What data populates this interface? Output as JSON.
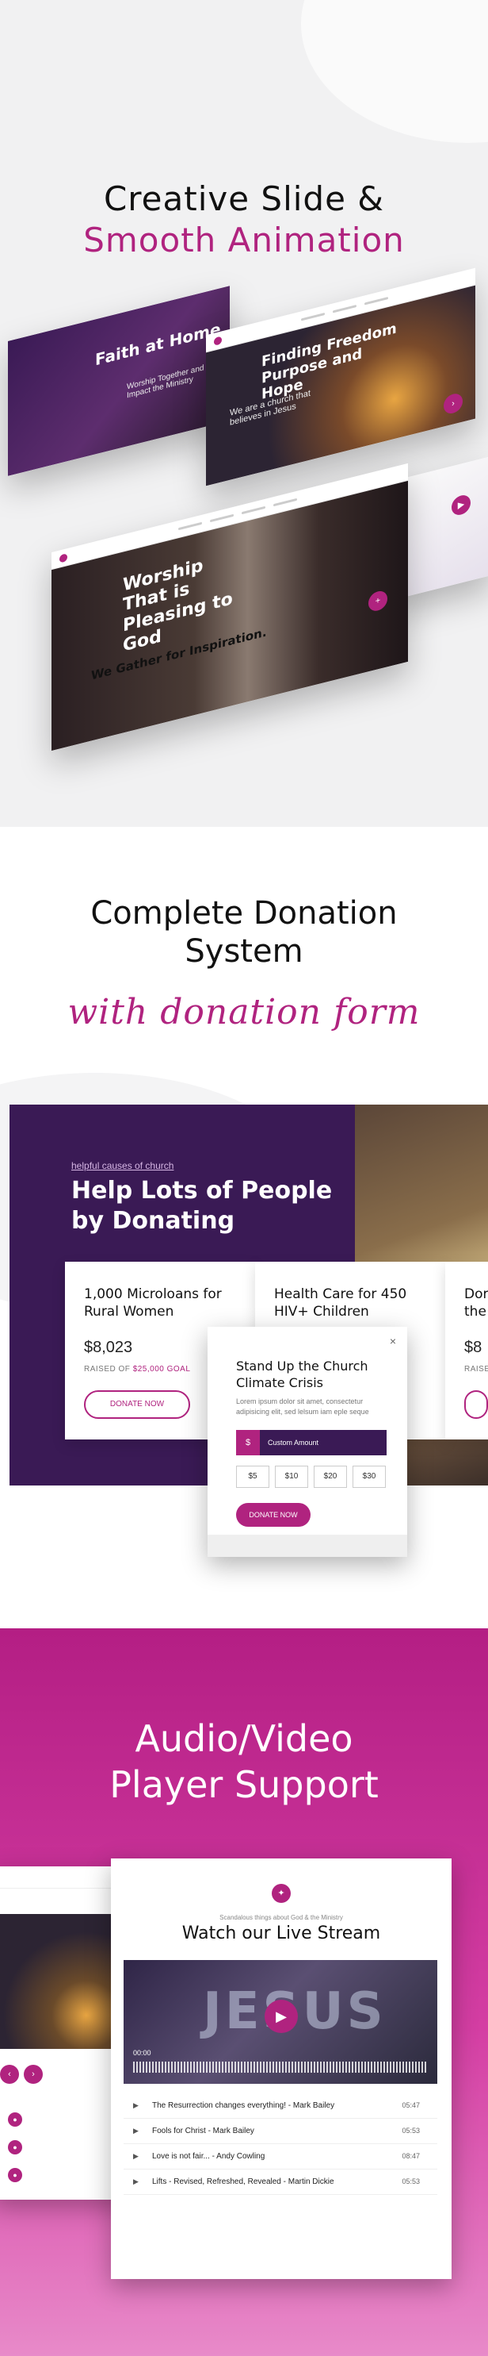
{
  "section1": {
    "heading_line1": "Creative Slide &",
    "heading_line2": "Smooth Animation",
    "slide_a": {
      "title": "Faith at Home",
      "sub": "Worship Together and Impact the Ministry"
    },
    "slide_b": {
      "title": "Finding Freedom Purpose and Hope",
      "sub": "We are a church that believes in Jesus"
    },
    "slide_c": {
      "title": "Worship That is Pleasing to God",
      "caption": "We Gather for Inspiration."
    }
  },
  "section2": {
    "heading_line1": "Complete Donation",
    "heading_line2": "System",
    "script": "with donation form",
    "link": "helpful causes of church",
    "big_line1": "Help Lots of People",
    "big_line2": "by Donating",
    "cards": [
      {
        "title_line1": "1,000 Microloans for",
        "title_line2": "Rural Women",
        "amount": "$8,023",
        "raised_prefix": "RAISED OF ",
        "raised_goal": "$25,000 GOAL",
        "button": "DONATE NOW"
      },
      {
        "title_line1": "Health Care for 450",
        "title_line2": "HIV+ Children"
      },
      {
        "title_line1": "Dor",
        "title_line2": "the",
        "amount": "$8",
        "raised_prefix": "RAISE"
      }
    ],
    "modal": {
      "close": "×",
      "title_line1": "Stand Up the Church",
      "title_line2": "Climate Crisis",
      "desc": "Lorem ipsum dolor sit amet, consectetur adipisicing elit, sed lelsum iam eple seque",
      "currency": "$",
      "custom": "Custom Amount",
      "amounts": [
        "$5",
        "$10",
        "$20",
        "$30"
      ],
      "button": "DONATE NOW"
    }
  },
  "section3": {
    "heading_line1": "Audio/Video",
    "heading_line2": "Player Support",
    "small": "Scandalous things about God & the Ministry",
    "title": "Watch our Live Stream",
    "video_word": "JESUS",
    "time": "00:00",
    "tracks": [
      {
        "title": "The Resurrection changes everything! - Mark Bailey",
        "length": "05:47"
      },
      {
        "title": "Fools for Christ - Mark Bailey",
        "length": "05:53"
      },
      {
        "title": "Love is not fair... - Andy Cowling",
        "length": "08:47"
      },
      {
        "title": "Lifts - Revised, Refreshed, Revealed - Martin Dickie",
        "length": "05:53"
      }
    ]
  },
  "colors": {
    "accent": "#b0237f",
    "purple": "#3a1a55"
  }
}
